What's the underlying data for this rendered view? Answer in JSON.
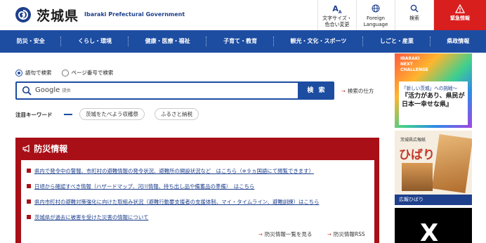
{
  "header": {
    "logo_text": "茨城県",
    "logo_en": "Ibaraki Prefectural Government",
    "buttons": [
      {
        "icon": "text-size-icon",
        "glyph": "AA",
        "line1": "文字サイズ・",
        "line2": "色合い変更"
      },
      {
        "icon": "globe-icon",
        "glyph": "⊕",
        "line1": "Foreign",
        "line2": "Language"
      },
      {
        "icon": "search-icon",
        "glyph": "⌕",
        "line1": "検索",
        "line2": ""
      },
      {
        "icon": "warning-icon",
        "glyph": "⚠",
        "line1": "緊急情報",
        "line2": ""
      }
    ]
  },
  "nav": [
    "防災・安全",
    "くらし・環境",
    "健康・医療・福祉",
    "子育て・教育",
    "観光・文化・スポーツ",
    "しごと・産業",
    "県政情報"
  ],
  "search": {
    "radio1": "語句で検索",
    "radio2": "ページ番号で検索",
    "placeholder": "Google",
    "placeholder_small": "提供",
    "button": "検 索",
    "how": "検索の仕方"
  },
  "keywords": {
    "title": "注目キーワード",
    "items": [
      "茨城をたべよう収穫祭",
      "ふるさと納税"
    ]
  },
  "disaster": {
    "title": "防災情報",
    "items": [
      "県内で発令中の警報、市町村の避難情報の発令状況、避難所の開設状況など　はこちら（※９ヵ国語にて閲覧できます）",
      "日頃から確認すべき情報（ハザードマップ、河川情報、持ち出し品や備蓄品の準備）　はこちら",
      "県内市町村の避難対策強化に向けた取組み状況（避難行動要支援者の支援体制、マイ・タイムライン、避難訓練）はこちら",
      "茨城県が過去に被害を受けた災害の情報について"
    ],
    "link_list": "防災情報一覧を見る",
    "link_rss": "防災情報RSS"
  },
  "sidebar": {
    "banner1_head1": "IBARAKI",
    "banner1_head2": "NEXT",
    "banner1_head3": "CHALLENGE",
    "banner1_line1": "「新しい茨城」への挑戦～",
    "banner1_line2": "『活力があり、県民が日本一幸せな県』",
    "banner2_head": "茨城県広報紙",
    "banner2_title": "ひばり",
    "banner2_label": "広報ひばり",
    "banner3_glyph": "X"
  },
  "colors": {
    "brand": "#1d4da1",
    "emergency": "#d91e1e",
    "disaster_panel": "#a90f17"
  }
}
